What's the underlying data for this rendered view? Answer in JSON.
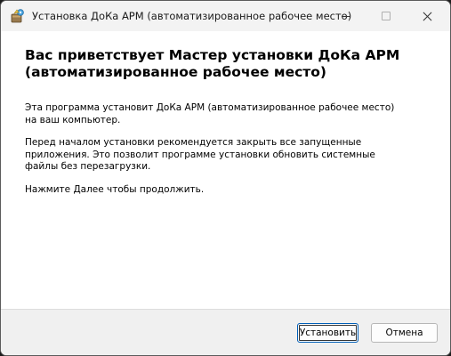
{
  "window": {
    "title": "Установка ДоКа АРМ (автоматизированное рабочее место)"
  },
  "titlebar": {
    "app_icon": "installer-icon",
    "minimize_icon": "minimize-icon",
    "maximize_icon": "maximize-icon",
    "close_icon": "close-icon"
  },
  "content": {
    "heading": "Вас приветствует Мастер установки ДоКа АРМ (автоматизированное рабочее место)",
    "paragraph1": "Эта программа установит ДоКа АРМ (автоматизированное рабочее место) на ваш компьютер.",
    "paragraph2": "Перед началом установки рекомендуется закрыть все запущенные приложения. Это позволит программе установки обновить системные файлы без перезагрузки.",
    "paragraph3": "Нажмите Далее чтобы продолжить."
  },
  "footer": {
    "install_label": "Установить",
    "cancel_label": "Отмена"
  },
  "colors": {
    "accent": "#005fb8",
    "titlebar_bg": "#f3f3f3",
    "footer_bg": "#f0f0f0"
  }
}
